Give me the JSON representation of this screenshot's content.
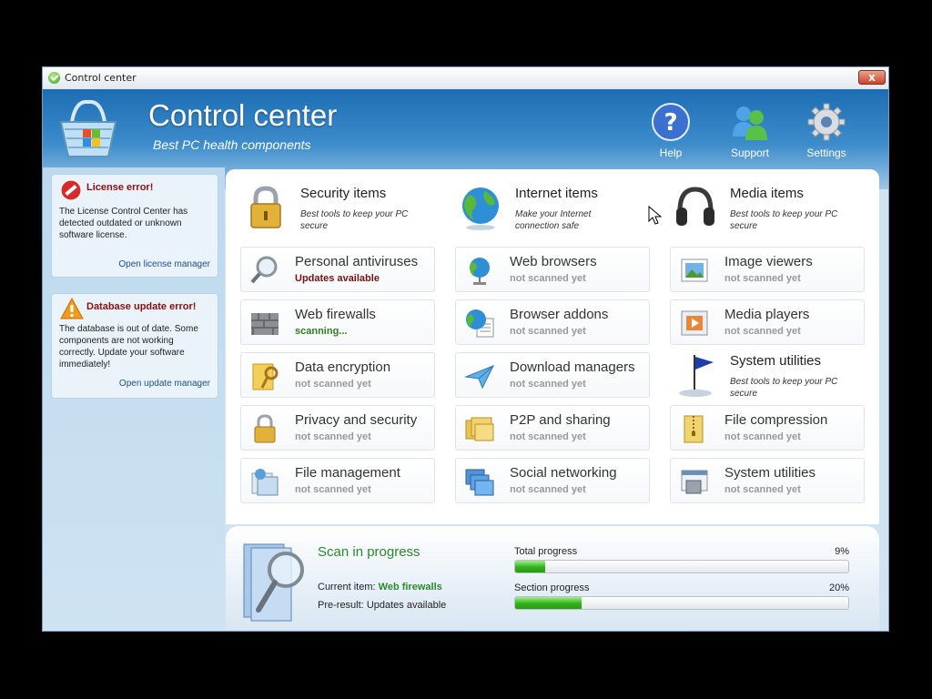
{
  "window": {
    "title": "Control center",
    "close_label": "x"
  },
  "header": {
    "title": "Control center",
    "subtitle": "Best PC health components",
    "buttons": [
      {
        "label": "Help",
        "icon": "help-icon"
      },
      {
        "label": "Support",
        "icon": "support-icon"
      },
      {
        "label": "Settings",
        "icon": "gear-icon"
      }
    ]
  },
  "sidebar": {
    "license": {
      "title": "License error!",
      "body": "The License Control Center has detected outdated or unknown software license.",
      "link": "Open license manager"
    },
    "database": {
      "title": "Database update error!",
      "body": "The database is out of date. Some components are not working correctly. Update your software immediately!",
      "link": "Open update manager"
    }
  },
  "categories": {
    "security": {
      "title": "Security items",
      "desc": "Best tools to keep your PC secure"
    },
    "internet": {
      "title": "Internet items",
      "desc": "Make your Internet connection safe"
    },
    "media": {
      "title": "Media items",
      "desc": "Best tools to keep your PC secure"
    },
    "system": {
      "title": "System utilities",
      "desc": "Best tools to keep your PC secure"
    }
  },
  "items": {
    "personal_antiviruses": {
      "name": "Personal antiviruses",
      "status": "Updates available"
    },
    "web_firewalls": {
      "name": "Web firewalls",
      "status": "scanning..."
    },
    "data_encryption": {
      "name": "Data encryption",
      "status": "not scanned yet"
    },
    "privacy_security": {
      "name": "Privacy and security",
      "status": "not scanned yet"
    },
    "file_management": {
      "name": "File management",
      "status": "not scanned yet"
    },
    "web_browsers": {
      "name": "Web browsers",
      "status": "not scanned yet"
    },
    "browser_addons": {
      "name": "Browser addons",
      "status": "not scanned yet"
    },
    "download_managers": {
      "name": "Download managers",
      "status": "not scanned yet"
    },
    "p2p_sharing": {
      "name": "P2P and sharing",
      "status": "not scanned yet"
    },
    "social_networking": {
      "name": "Social networking",
      "status": "not scanned yet"
    },
    "image_viewers": {
      "name": "Image viewers",
      "status": "not scanned yet"
    },
    "media_players": {
      "name": "Media players",
      "status": "not scanned yet"
    },
    "file_compression": {
      "name": "File compression",
      "status": "not scanned yet"
    },
    "system_utilities": {
      "name": "System utilities",
      "status": "not scanned yet"
    }
  },
  "scan": {
    "title": "Scan in progress",
    "current_label": "Current item:",
    "current_value": "Web firewalls",
    "preresult_label": "Pre-result:",
    "preresult_value": "Updates available",
    "total_label": "Total progress",
    "total_pct": "9%",
    "total_value": 0.09,
    "section_label": "Section progress",
    "section_pct": "20%",
    "section_value": 0.2
  },
  "colors": {
    "accent_green": "#2a8a2a",
    "error_red": "#8a1010",
    "header_blue": "#1d6db4"
  }
}
